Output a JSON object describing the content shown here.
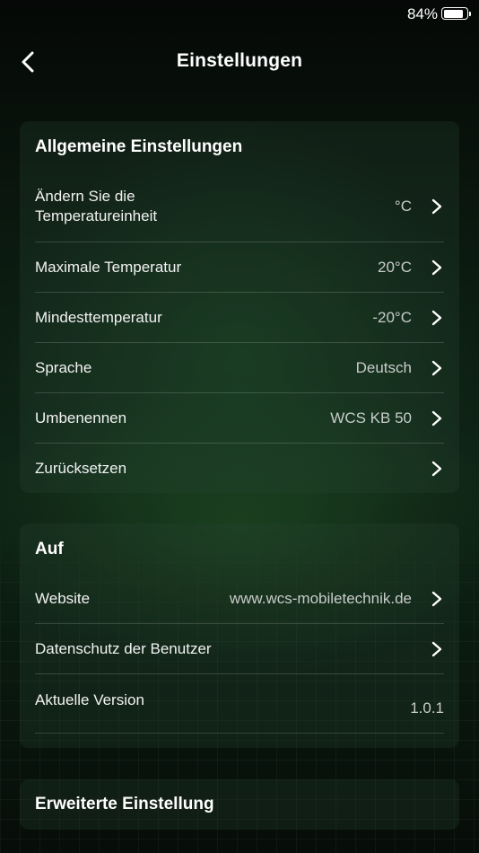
{
  "status_bar": {
    "battery_percent": "84%",
    "battery_level": 0.84
  },
  "header": {
    "title": "Einstellungen",
    "back_icon": "chevron-left-icon"
  },
  "general": {
    "title": "Allgemeine Einstellungen",
    "items": [
      {
        "label": "Ändern Sie die Temperatureinheit",
        "value": "°C"
      },
      {
        "label": "Maximale Temperatur",
        "value": "20°C"
      },
      {
        "label": "Mindesttemperatur",
        "value": "-20°C"
      },
      {
        "label": "Sprache",
        "value": "Deutsch"
      },
      {
        "label": "Umbenennen",
        "value": "WCS KB 50"
      },
      {
        "label": "Zurücksetzen",
        "value": ""
      }
    ]
  },
  "about": {
    "title": "Auf",
    "items": [
      {
        "label": "Website",
        "value": "www.wcs-mobiletechnik.de"
      },
      {
        "label": "Datenschutz der Benutzer",
        "value": ""
      },
      {
        "label": "Aktuelle Version",
        "value": "1.0.1"
      }
    ]
  },
  "advanced": {
    "title": "Erweiterte Einstellung"
  },
  "colors": {
    "text": "#ffffff",
    "value_text": "#c8ccc9",
    "background": "#0f2516",
    "card": "#1c3324"
  }
}
